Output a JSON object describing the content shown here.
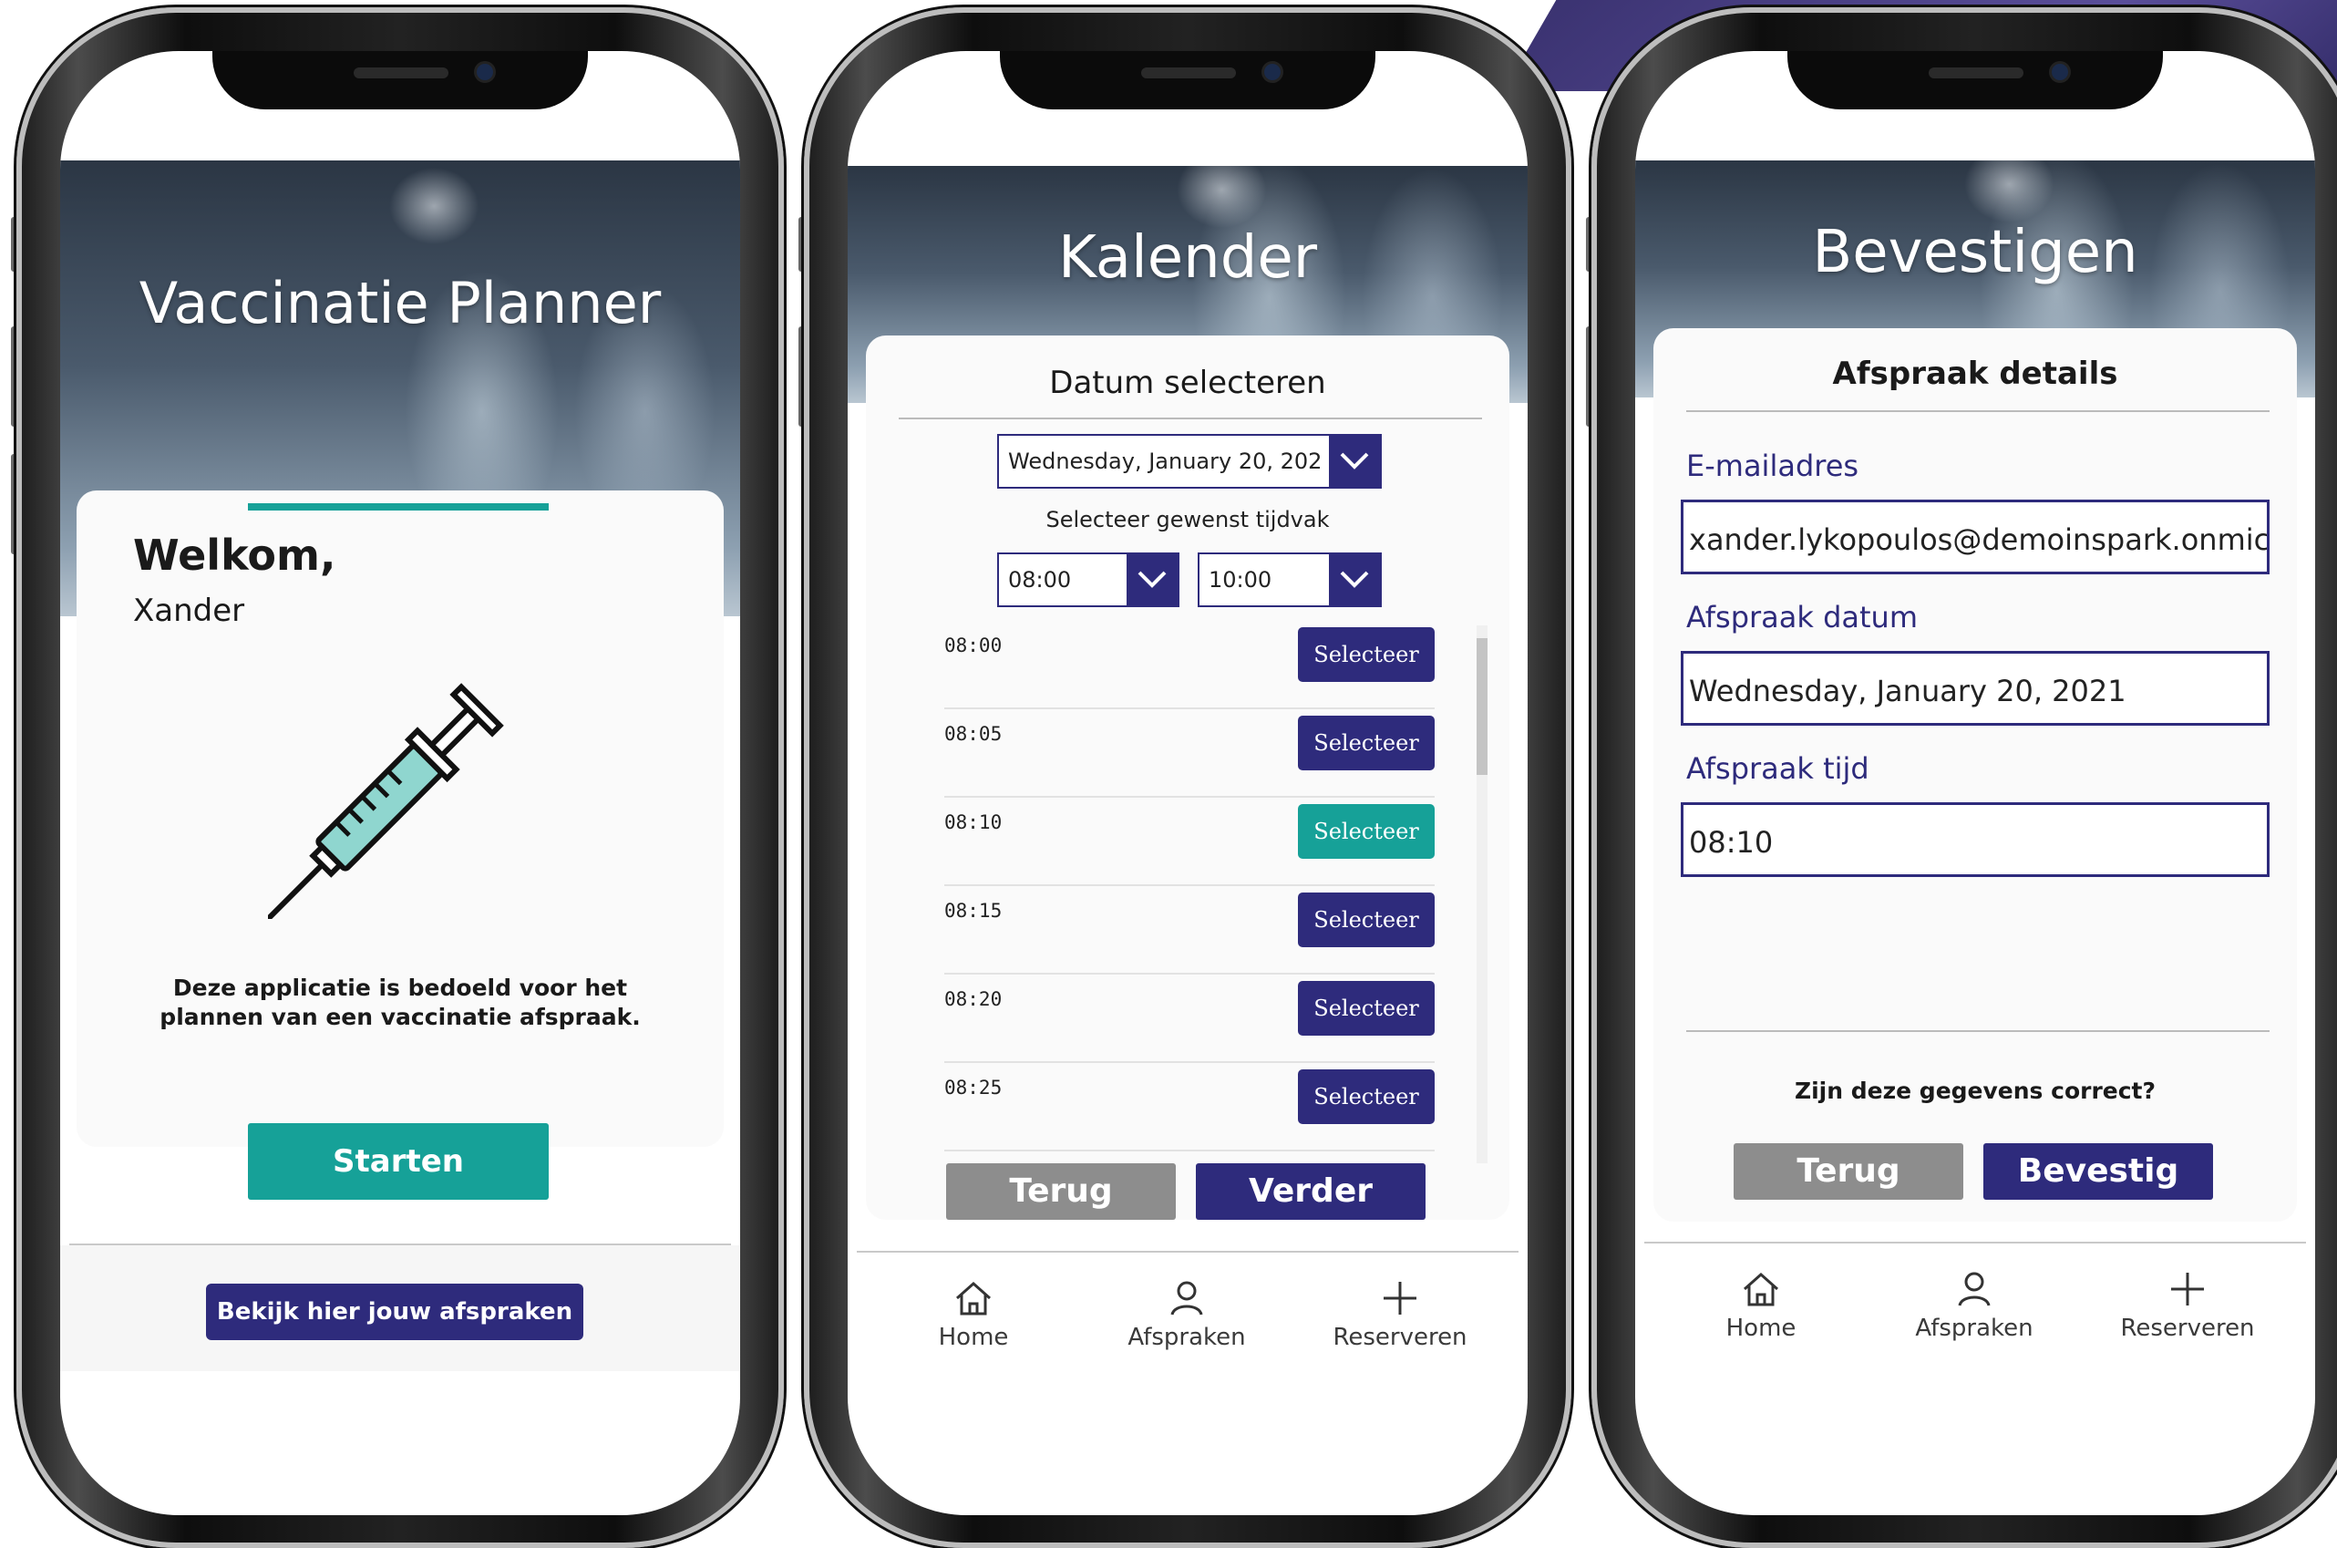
{
  "phone1": {
    "title": "Vaccinatie Planner",
    "welcome": "Welkom,",
    "user": "Xander",
    "description": "Deze applicatie is bedoeld voor het plannen van een vaccinatie afspraak.",
    "start_label": "Starten",
    "appointments_link": "Bekijk hier jouw afspraken"
  },
  "phone2": {
    "title": "Kalender",
    "card_title": "Datum selecteren",
    "date_value": "Wednesday, January 20, 202",
    "slot_label": "Selecteer gewenst tijdvak",
    "from_time": "08:00",
    "to_time": "10:00",
    "slots": [
      {
        "time": "08:00",
        "button": "Selecteer"
      },
      {
        "time": "08:05",
        "button": "Selecteer"
      },
      {
        "time": "08:10",
        "button": "Selecteer"
      },
      {
        "time": "08:15",
        "button": "Selecteer"
      },
      {
        "time": "08:20",
        "button": "Selecteer"
      },
      {
        "time": "08:25",
        "button": "Selecteer"
      }
    ],
    "back_label": "Terug",
    "next_label": "Verder"
  },
  "phone3": {
    "title": "Bevestigen",
    "card_title": "Afspraak details",
    "email_label": "E-mailadres",
    "email_value": "xander.lykopoulos@demoinspark.onmicr",
    "date_label": "Afspraak datum",
    "date_value": "Wednesday, January 20, 2021",
    "time_label": "Afspraak tijd",
    "time_value": "08:10",
    "question": "Zijn deze gegevens correct?",
    "back_label": "Terug",
    "confirm_label": "Bevestig"
  },
  "nav": {
    "home": "Home",
    "appointments": "Afspraken",
    "reserve": "Reserveren"
  },
  "colors": {
    "teal": "#16a198",
    "navy": "#2e2b7c",
    "gray": "#8d8d8d"
  }
}
